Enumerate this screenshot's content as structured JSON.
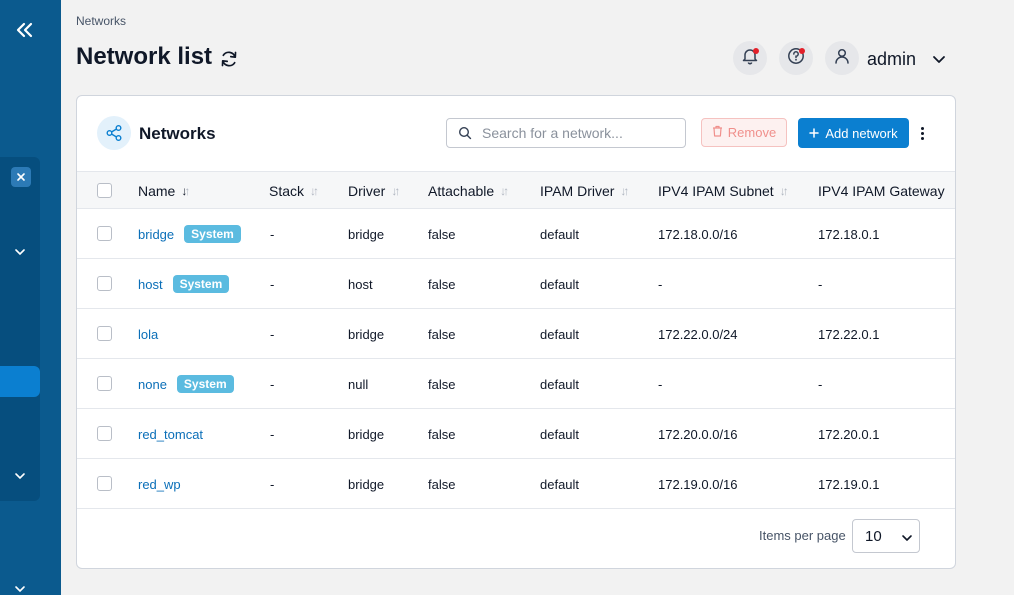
{
  "breadcrumb": "Networks",
  "page_title": "Network list",
  "header": {
    "user_name": "admin"
  },
  "card": {
    "title": "Networks",
    "search_placeholder": "Search for a network...",
    "remove_label": "Remove",
    "add_label": "Add network"
  },
  "columns": [
    "Name",
    "Stack",
    "Driver",
    "Attachable",
    "IPAM Driver",
    "IPV4 IPAM Subnet",
    "IPV4 IPAM Gateway"
  ],
  "rows": [
    {
      "name": "bridge",
      "badge": "System",
      "stack": "-",
      "driver": "bridge",
      "attachable": "false",
      "ipam_driver": "default",
      "subnet": "172.18.0.0/16",
      "gateway": "172.18.0.1"
    },
    {
      "name": "host",
      "badge": "System",
      "stack": "-",
      "driver": "host",
      "attachable": "false",
      "ipam_driver": "default",
      "subnet": "-",
      "gateway": "-"
    },
    {
      "name": "lola",
      "badge": "",
      "stack": "-",
      "driver": "bridge",
      "attachable": "false",
      "ipam_driver": "default",
      "subnet": "172.22.0.0/24",
      "gateway": "172.22.0.1"
    },
    {
      "name": "none",
      "badge": "System",
      "stack": "-",
      "driver": "null",
      "attachable": "false",
      "ipam_driver": "default",
      "subnet": "-",
      "gateway": "-"
    },
    {
      "name": "red_tomcat",
      "badge": "",
      "stack": "-",
      "driver": "bridge",
      "attachable": "false",
      "ipam_driver": "default",
      "subnet": "172.20.0.0/16",
      "gateway": "172.20.0.1"
    },
    {
      "name": "red_wp",
      "badge": "",
      "stack": "-",
      "driver": "bridge",
      "attachable": "false",
      "ipam_driver": "default",
      "subnet": "172.19.0.0/16",
      "gateway": "172.19.0.1"
    }
  ],
  "footer": {
    "items_per_page_label": "Items per page",
    "items_per_page_value": "10"
  },
  "colors": {
    "sidebar": "#0b5a8e",
    "primary": "#0b7fd0",
    "link": "#0b6fb8",
    "badge": "#5bbbe0",
    "danger_light": "#fdf1f0"
  }
}
